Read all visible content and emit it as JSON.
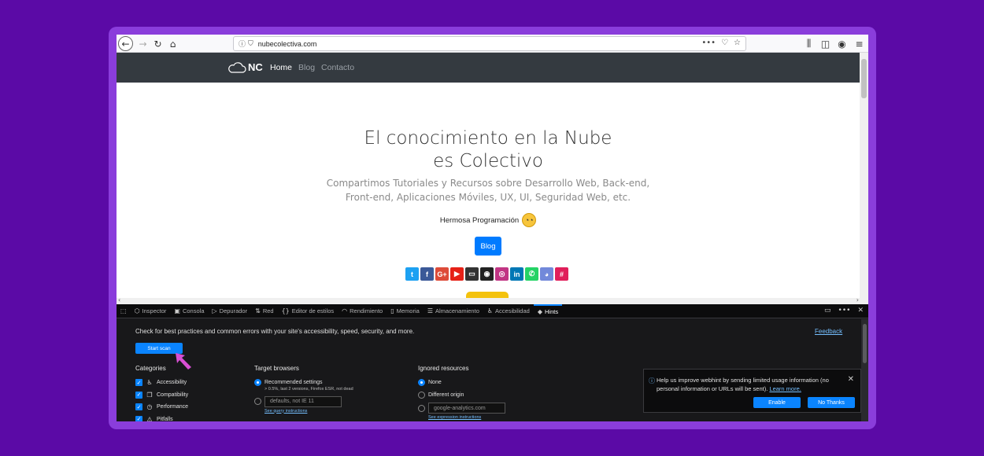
{
  "browser": {
    "url": "nubecolectiva.com",
    "icons": [
      "back-icon",
      "forward-icon",
      "reload-icon",
      "home-icon",
      "info-icon",
      "shield-icon",
      "more-icon",
      "pocket-icon",
      "star-icon",
      "library-icon",
      "sidebar-icon",
      "account-icon",
      "menu-icon"
    ]
  },
  "site": {
    "brand": "NC",
    "nav": [
      "Home",
      "Blog",
      "Contacto"
    ],
    "title_line1": "El conocimiento en la Nube",
    "title_line2": "es Colectivo",
    "subtitle_line1": "Compartimos Tutoriales y Recursos sobre Desarrollo Web, Back-end,",
    "subtitle_line2": "Front-end, Aplicaciones Móviles, UX, UI, Seguridad Web, etc.",
    "tagline": "Hermosa Programación",
    "blog_button": "Blog",
    "socials": [
      {
        "name": "twitter-icon",
        "glyph": "t",
        "color": "#1da1f2"
      },
      {
        "name": "facebook-icon",
        "glyph": "f",
        "color": "#3b5998"
      },
      {
        "name": "google-plus-icon",
        "glyph": "G+",
        "color": "#dd4b39"
      },
      {
        "name": "youtube-icon",
        "glyph": "▶",
        "color": "#e62117"
      },
      {
        "name": "video-icon",
        "glyph": "▭",
        "color": "#333333"
      },
      {
        "name": "github-icon",
        "glyph": "◉",
        "color": "#222222"
      },
      {
        "name": "instagram-icon",
        "glyph": "◎",
        "color": "#c13584"
      },
      {
        "name": "linkedin-icon",
        "glyph": "in",
        "color": "#0077b5"
      },
      {
        "name": "whatsapp-icon",
        "glyph": "✆",
        "color": "#25d366"
      },
      {
        "name": "discord-icon",
        "glyph": "◕",
        "color": "#7289da"
      },
      {
        "name": "slack-icon",
        "glyph": "#",
        "color": "#e01e5a"
      }
    ]
  },
  "devtools": {
    "tabs": [
      {
        "label": "Inspector",
        "icon": "⬡"
      },
      {
        "label": "Consola",
        "icon": "▣"
      },
      {
        "label": "Depurador",
        "icon": "▷"
      },
      {
        "label": "Red",
        "icon": "⇅"
      },
      {
        "label": "Editor de estilos",
        "icon": "{}"
      },
      {
        "label": "Rendimiento",
        "icon": "◠"
      },
      {
        "label": "Memoria",
        "icon": "▯"
      },
      {
        "label": "Almacenamiento",
        "icon": "☰"
      },
      {
        "label": "Accesibilidad",
        "icon": "♿"
      },
      {
        "label": "Hints",
        "icon": "◆"
      }
    ],
    "active_tab": "Hints",
    "hint_text": "Check for best practices and common errors with your site's accessibility, speed, security, and more.",
    "feedback": "Feedback",
    "start_scan": "Start scan",
    "categories_title": "Categories",
    "categories": [
      {
        "label": "Accessibility",
        "icon": "♿"
      },
      {
        "label": "Compatibility",
        "icon": "❐"
      },
      {
        "label": "Performance",
        "icon": "◷"
      },
      {
        "label": "Pitfalls",
        "icon": "⚠"
      }
    ],
    "browsers_title": "Target browsers",
    "recommended": "Recommended settings",
    "recommended_sub": "> 0.5%, last 2 versions, Firefox ESR, not dead",
    "browsers_placeholder": "defaults, not IE 11",
    "query_link": "See query instructions",
    "ignored_title": "Ignored resources",
    "ignored_none": "None",
    "ignored_different": "Different origin",
    "ignored_placeholder": "google-analytics.com",
    "expression_link": "See expression instructions",
    "notice_text": "Help us improve webhint by sending limited usage information (no personal information or URLs will be sent).",
    "notice_link": "Learn more.",
    "enable": "Enable",
    "no_thanks": "No Thanks"
  }
}
